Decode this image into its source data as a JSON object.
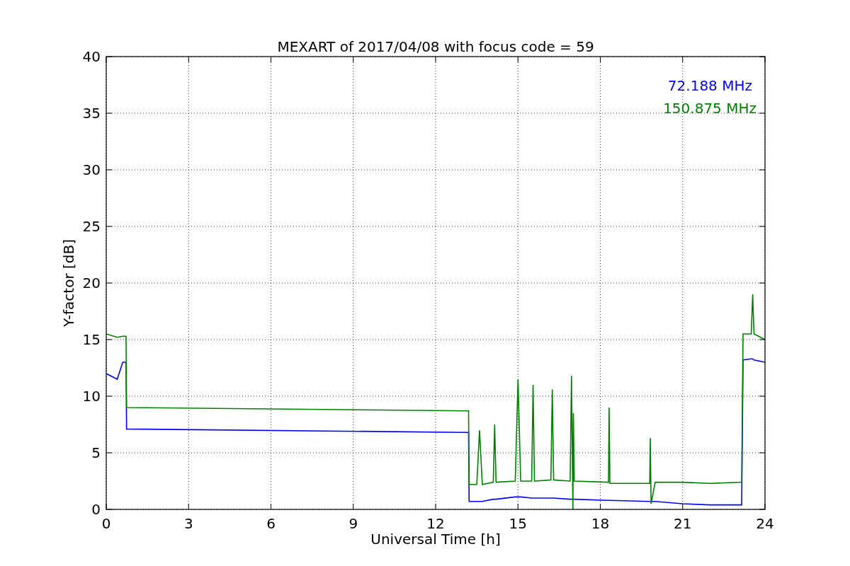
{
  "figure": {
    "chart_data": {
      "type": "line",
      "title": "MEXART of 2017/04/08 with focus code = 59",
      "xlabel": "Universal Time [h]",
      "ylabel": "Y-factor [dB]",
      "x": [
        0,
        0.4,
        0.6,
        0.72,
        0.74,
        13.2,
        13.22,
        13.5,
        13.6,
        13.7,
        14.1,
        14.15,
        14.2,
        14.9,
        15.0,
        15.1,
        15.5,
        15.55,
        15.6,
        16.2,
        16.25,
        16.3,
        16.9,
        16.95,
        17.0,
        17.02,
        17.05,
        18.3,
        18.32,
        18.35,
        19.8,
        19.82,
        19.85,
        20.0,
        21.0,
        22.0,
        23.15,
        23.2,
        23.5,
        23.55,
        23.6,
        24
      ],
      "series": [
        {
          "name": "72.188 MHz",
          "color": "#0000ff",
          "values": [
            12,
            11.5,
            13,
            13,
            7.1,
            6.8,
            0.7,
            0.7,
            0.7,
            0.7,
            0.9,
            0.9,
            0.9,
            1.1,
            1.1,
            1.1,
            1.0,
            1.0,
            1.0,
            1.0,
            1.0,
            1.0,
            0.9,
            0.9,
            0.9,
            0.9,
            0.9,
            0.8,
            0.8,
            0.8,
            0.7,
            0.7,
            0.7,
            0.7,
            0.5,
            0.4,
            0.4,
            13.2,
            13.3,
            13.3,
            13.2,
            13.0
          ]
        },
        {
          "name": "150.875 MHz",
          "color": "#008000",
          "values": [
            15.5,
            15.2,
            15.3,
            15.3,
            9.0,
            8.7,
            2.2,
            2.2,
            7.0,
            2.2,
            2.4,
            7.5,
            2.4,
            2.5,
            11.5,
            2.5,
            2.5,
            11.0,
            2.5,
            2.6,
            10.6,
            2.6,
            2.5,
            11.8,
            0.0,
            8.5,
            2.5,
            2.4,
            9.0,
            2.3,
            2.3,
            6.3,
            0.5,
            2.4,
            2.4,
            2.3,
            2.4,
            15.5,
            15.5,
            19.0,
            15.5,
            15.0
          ]
        }
      ],
      "xlim": [
        0,
        24
      ],
      "ylim": [
        0,
        40
      ],
      "xticks": [
        0,
        3,
        6,
        9,
        12,
        15,
        18,
        21,
        24
      ],
      "yticks": [
        0,
        5,
        10,
        15,
        20,
        25,
        30,
        35,
        40
      ],
      "grid": true
    }
  }
}
